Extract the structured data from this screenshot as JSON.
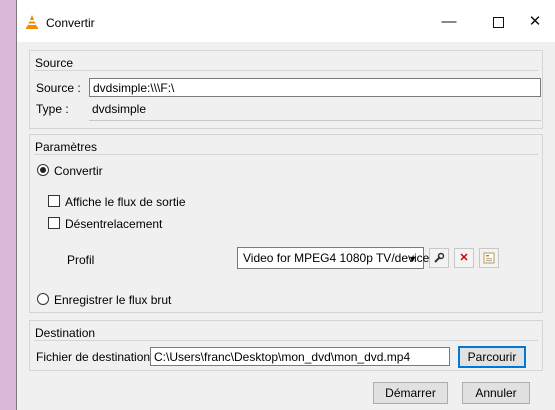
{
  "window": {
    "title": "Convertir"
  },
  "source": {
    "group_title": "Source",
    "source_label": "Source :",
    "source_value": "dvdsimple:\\\\\\F:\\",
    "type_label": "Type :",
    "type_value": "dvdsimple"
  },
  "params": {
    "group_title": "Paramètres",
    "convert_label": "Convertir",
    "convert_selected": true,
    "show_output_label": "Affiche le flux de sortie",
    "deinterlace_label": "Désentrelacement",
    "profile_label": "Profil",
    "profile_value": "Video for MPEG4 1080p TV/device",
    "raw_label": "Enregistrer le flux brut"
  },
  "destination": {
    "group_title": "Destination",
    "file_label": "Fichier de destination :",
    "file_value": "C:\\Users\\franc\\Desktop\\mon_dvd\\mon_dvd.mp4",
    "browse_label": "Parcourir"
  },
  "footer": {
    "start_label": "Démarrer",
    "cancel_label": "Annuler"
  },
  "colors": {
    "accent": "#0078d7",
    "delete_icon": "#d40000",
    "vlc_orange": "#f08c00"
  }
}
